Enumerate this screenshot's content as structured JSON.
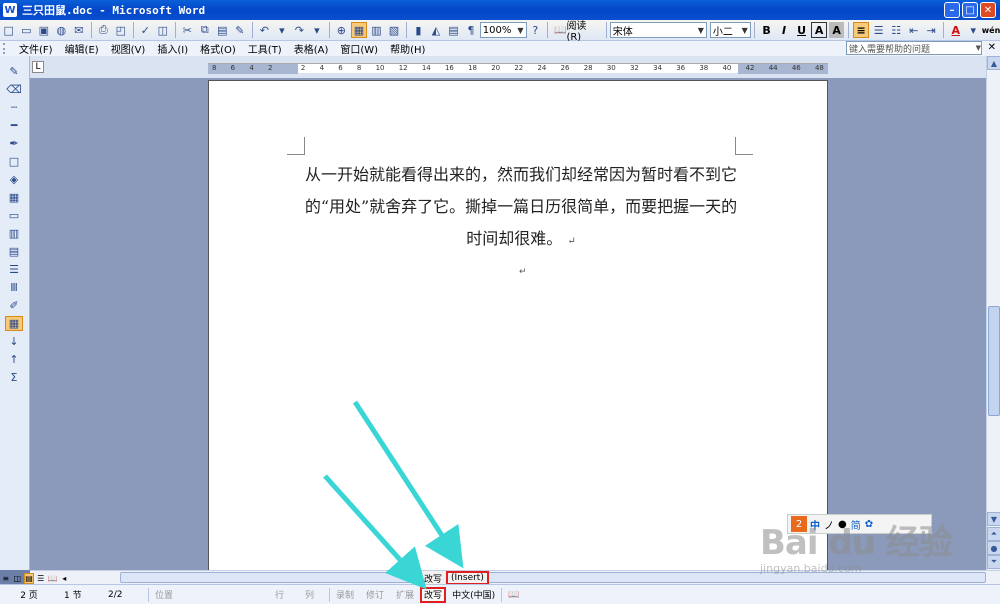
{
  "window": {
    "title": "三只田鼠.doc - Microsoft Word",
    "app_icon": "W",
    "minimize": "–",
    "maximize": "□",
    "close": "✕"
  },
  "standard_toolbar": {
    "zoom": "100%",
    "read_label": "阅读(R)",
    "font_name": "宋体",
    "font_size": "小二",
    "bold": "B",
    "italic": "I",
    "underline": "U",
    "char_border": "A",
    "char_shade": "A",
    "font_color": "A",
    "phonetic": "wén"
  },
  "menubar": {
    "items": [
      "文件(F)",
      "编辑(E)",
      "视图(V)",
      "插入(I)",
      "格式(O)",
      "工具(T)",
      "表格(A)",
      "窗口(W)",
      "帮助(H)"
    ],
    "help_placeholder": "键入需要帮助的问题",
    "close": "✕"
  },
  "ruler": {
    "tab_selector": "L",
    "labels": [
      "8",
      "6",
      "4",
      "2",
      "",
      "2",
      "4",
      "6",
      "8",
      "10",
      "12",
      "14",
      "16",
      "18",
      "20",
      "22",
      "24",
      "26",
      "28",
      "30",
      "32",
      "34",
      "36",
      "38",
      "40",
      "42",
      "44",
      "46",
      "48"
    ]
  },
  "document": {
    "paragraph": "从一开始就能看得出来的，然而我们却经常因为暂时看不到它的“用处”就舍弃了它。撕掉一篇日历很简单，而要把握一天的时间却很难。",
    "para_mark": "↵",
    "empty_para_mark": "↵"
  },
  "ime": {
    "logo": "2",
    "lang": "中",
    "punct": "ノ",
    "mode": "简"
  },
  "hscroll": {
    "ovr_label": "改写",
    "insert_label": "(Insert)"
  },
  "statusbar": {
    "page": "2 页",
    "section": "1 节",
    "page_of": "2/2",
    "position": "位置",
    "line": "行",
    "column": "列",
    "rec": "录制",
    "trk": "修订",
    "ext": "扩展",
    "ovr": "改写",
    "language": "中文(中国)"
  },
  "watermark": {
    "brand": "Bai du 经验",
    "url": "jingyan.baidu.com"
  },
  "colors": {
    "title_bar": "#0a4fd0",
    "highlight_box": "#e02020",
    "arrow": "#3ad6d6",
    "doc_background": "#8b9aba"
  }
}
